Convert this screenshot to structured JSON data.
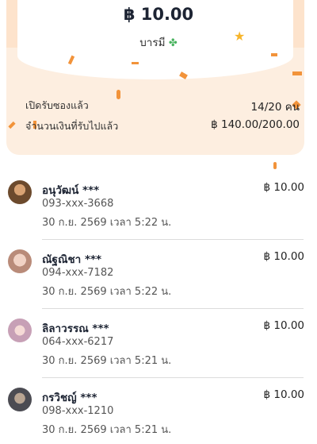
{
  "header": {
    "amount": "฿ 10.00",
    "label": "บารมี",
    "clover_icon": "clover-icon"
  },
  "stats": {
    "opened_label": "เปิดรับซองแล้ว",
    "opened_value": "14/20 คน",
    "received_label": "จำนวนเงินที่รับไปแล้ว",
    "received_value": "฿ 140.00/200.00"
  },
  "colors": {
    "summary_bg": "#fdeee0",
    "confetti": "#f2933a",
    "star": "#f7b52b",
    "clover": "#49b35f"
  },
  "receivers": [
    {
      "name": "อนุวัฒน์ ***",
      "phone": "093-xxx-3668",
      "time": "30 ก.ย. 2569 เวลา 5:22 น.",
      "amount": "฿ 10.00"
    },
    {
      "name": "ณัฐณิชา ***",
      "phone": "094-xxx-7182",
      "time": "30 ก.ย. 2569 เวลา 5:22 น.",
      "amount": "฿ 10.00"
    },
    {
      "name": "ลิลาวรรณ ***",
      "phone": "064-xxx-6217",
      "time": "30 ก.ย. 2569 เวลา 5:21 น.",
      "amount": "฿ 10.00"
    },
    {
      "name": "กรวิชญ์ ***",
      "phone": "098-xxx-1210",
      "time": "30 ก.ย. 2569 เวลา 5:21 น.",
      "amount": "฿ 10.00"
    }
  ]
}
